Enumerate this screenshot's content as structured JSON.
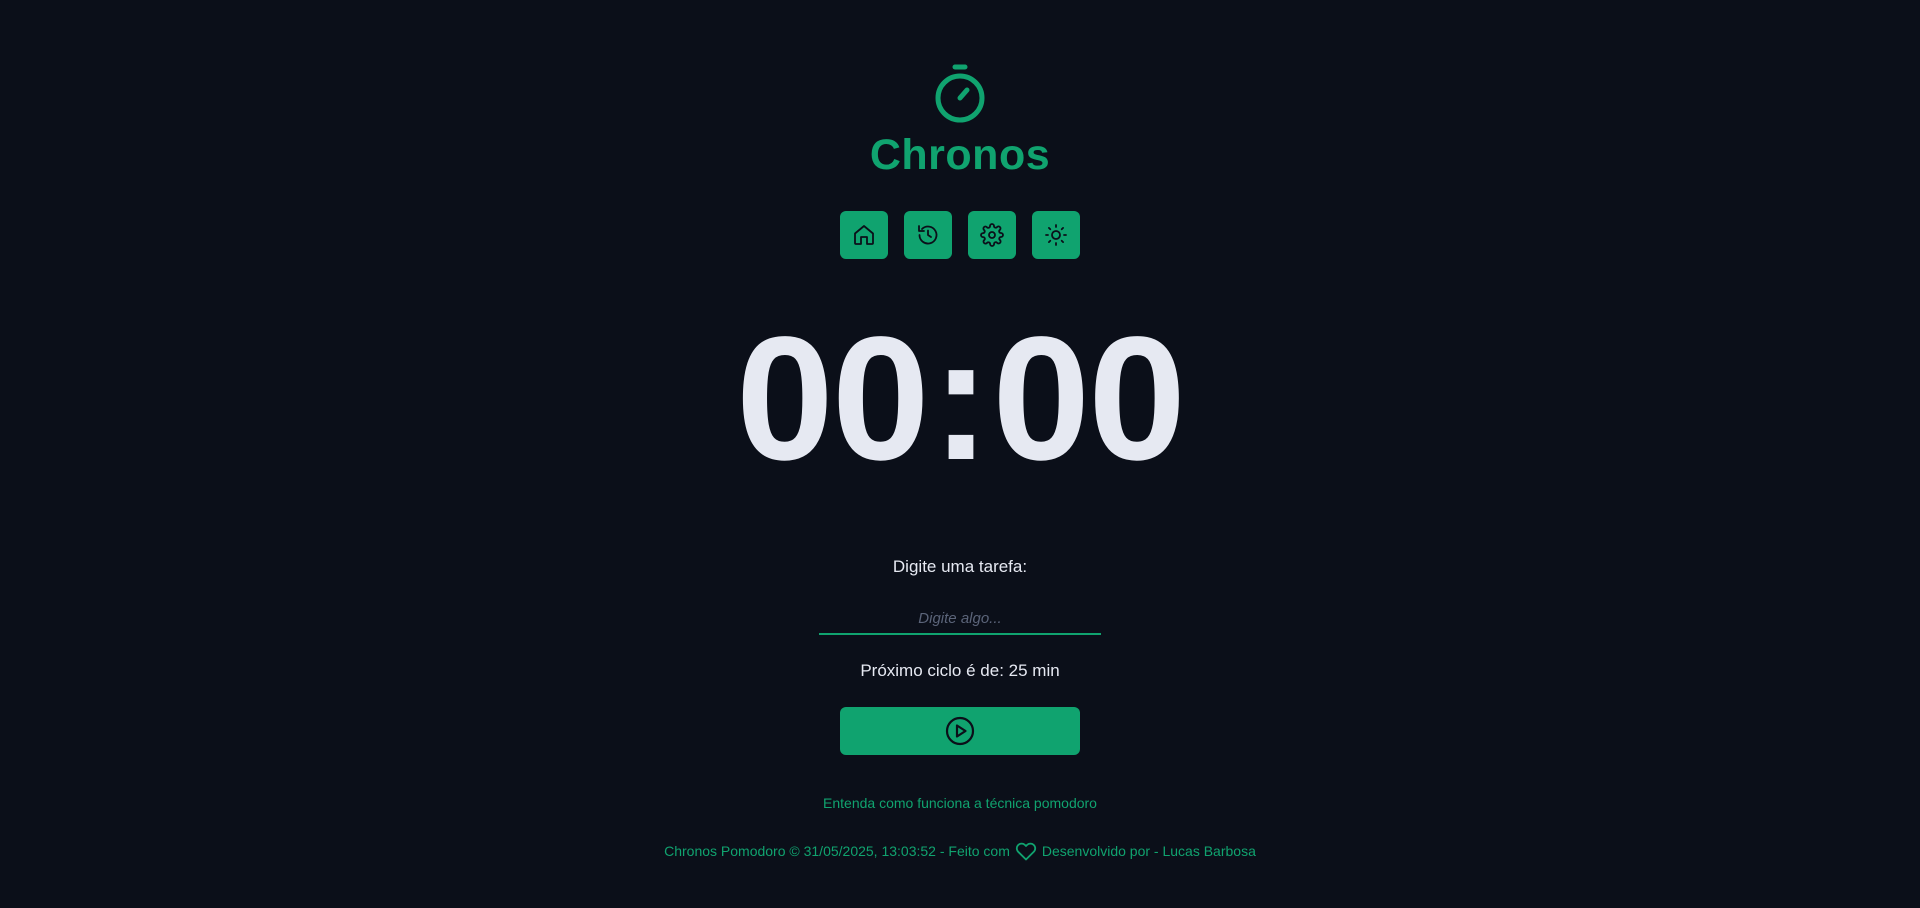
{
  "app": {
    "title": "Chronos",
    "logo_icon": "stopwatch-icon",
    "accent_color": "#10a36f",
    "background_color": "#0b0f19"
  },
  "menu": {
    "items": [
      {
        "name": "home",
        "icon": "home-icon"
      },
      {
        "name": "history",
        "icon": "history-icon"
      },
      {
        "name": "settings",
        "icon": "gear-icon"
      },
      {
        "name": "theme",
        "icon": "sun-icon"
      }
    ]
  },
  "timer": {
    "minutes": "00",
    "separator": ":",
    "seconds": "00"
  },
  "task": {
    "label": "Digite uma tarefa:",
    "value": "",
    "placeholder": "Digite algo..."
  },
  "cycle": {
    "text": "Próximo ciclo é de: 25 min"
  },
  "play_button": {
    "icon": "play-circle-icon"
  },
  "links": {
    "pomodoro": "Entenda como funciona a técnica pomodoro"
  },
  "footer": {
    "prefix": "Chronos Pomodoro © 31/05/2025, 13:03:52 - Feito com",
    "heart_icon": "heart-icon",
    "suffix": "Desenvolvido por - Lucas Barbosa"
  }
}
